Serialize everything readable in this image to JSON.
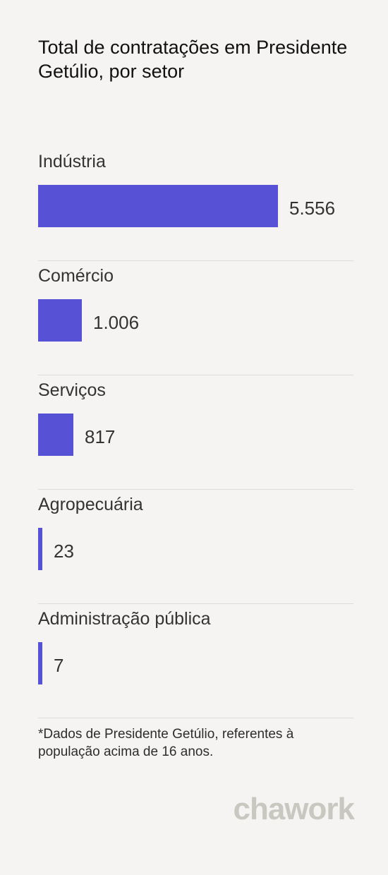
{
  "title": "Total de contratações em Presidente Getúlio, por setor",
  "chart_data": {
    "type": "bar",
    "orientation": "horizontal",
    "title": "Total de contratações em Presidente Getúlio, por setor",
    "categories": [
      "Indústria",
      "Comércio",
      "Serviços",
      "Agropecuária",
      "Administração pública"
    ],
    "values": [
      5556,
      1006,
      817,
      23,
      7
    ],
    "value_labels": [
      "5.556",
      "1.006",
      "817",
      "23",
      "7"
    ],
    "xlim": [
      0,
      5556
    ],
    "grid": false,
    "bar_color": "#5751d6"
  },
  "footnote": "*Dados de Presidente Getúlio, referentes à população acima de 16 anos.",
  "logo": "chawork",
  "colors": {
    "background": "#f5f4f2",
    "bar": "#5751d6",
    "logo": "#c9c8c0"
  }
}
